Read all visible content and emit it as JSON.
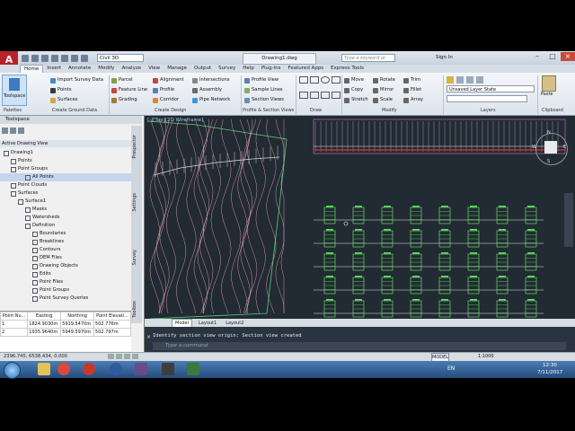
{
  "titlebar": {
    "logo": "A",
    "workspace": "Civil 3D",
    "doc_title": "Drawing1.dwg",
    "search_placeholder": "Type a keyword or phrase",
    "signin": "Sign In"
  },
  "ribbon_tabs": [
    "Home",
    "Insert",
    "Annotate",
    "Modify",
    "Analyze",
    "View",
    "Manage",
    "Output",
    "Survey",
    "Help",
    "Plug-ins",
    "Featured Apps",
    "Express Tools"
  ],
  "ribbon": {
    "toolspace_label": "Toolspace",
    "palettes": "Palettes",
    "create_ground": [
      "Import Survey Data",
      "Points",
      "Surfaces"
    ],
    "create_ground_title": "Create Ground Data",
    "design1": [
      "Parcel",
      "Feature Line",
      "Grading"
    ],
    "design2": [
      "Alignment",
      "Profile",
      "Corridor"
    ],
    "design3": [
      "Intersections",
      "Assembly",
      "Pipe Network"
    ],
    "create_design_title": "Create Design",
    "profile_views": [
      "Profile View",
      "Sample Lines",
      "Section Views"
    ],
    "profile_title": "Profile & Section Views",
    "draw_title": "Draw",
    "modify1": [
      "Move",
      "Copy",
      "Stretch"
    ],
    "modify2": [
      "Rotate",
      "Mirror",
      "Scale"
    ],
    "modify3": [
      "Trim",
      "Fillet",
      "Array"
    ],
    "modify_title": "Modify",
    "layer_state": "Unsaved Layer State",
    "layers_title": "Layers",
    "paste": "Paste",
    "clipboard_title": "Clipboard"
  },
  "toolspace": {
    "header": "Toolspace",
    "view_combo": "Active Drawing View",
    "tree": [
      {
        "label": "Drawing1",
        "indent": 0
      },
      {
        "label": "Points",
        "indent": 1
      },
      {
        "label": "Point Groups",
        "indent": 1
      },
      {
        "label": "All Points",
        "indent": 3,
        "selected": true
      },
      {
        "label": "Point Clouds",
        "indent": 1
      },
      {
        "label": "Surfaces",
        "indent": 1
      },
      {
        "label": "Surface1",
        "indent": 2
      },
      {
        "label": "Masks",
        "indent": 3
      },
      {
        "label": "Watersheds",
        "indent": 3
      },
      {
        "label": "Definition",
        "indent": 3
      },
      {
        "label": "Boundaries",
        "indent": 4
      },
      {
        "label": "Breaklines",
        "indent": 4
      },
      {
        "label": "Contours",
        "indent": 4
      },
      {
        "label": "DEM Files",
        "indent": 4
      },
      {
        "label": "Drawing Objects",
        "indent": 4
      },
      {
        "label": "Edits",
        "indent": 4
      },
      {
        "label": "Point Files",
        "indent": 4
      },
      {
        "label": "Point Groups",
        "indent": 4
      },
      {
        "label": "Point Survey Queries",
        "indent": 4
      }
    ],
    "vtabs": [
      "Prospector",
      "Settings",
      "Survey",
      "Toolbox"
    ],
    "grid_headers": [
      "Point Nu...",
      "Easting",
      "Northing",
      "Point Elevati..."
    ],
    "grid_rows": [
      [
        "1",
        "1824.9030m",
        "5919.5470m",
        "502.776m"
      ],
      [
        "2",
        "1935.9640m",
        "5949.5970m",
        "502.797m"
      ]
    ]
  },
  "drawing": {
    "view_label": "[-][Top][2D Wireframe]",
    "viewcube_top": "TOP",
    "compass": [
      "N",
      "S",
      "W",
      "E"
    ],
    "layout_tabs": [
      "Model",
      "Layout1",
      "Layout2"
    ],
    "section_columns": 8,
    "section_rows": 5
  },
  "command": {
    "history": "Identify section view origin: Section view created",
    "prompt": "Type a command"
  },
  "status": {
    "coords": "2396.745, 6538.434, 0.000",
    "model": "MODEL",
    "scale": "1:1000"
  },
  "taskbar": {
    "lang": "EN",
    "time": "12:30",
    "date": "7/11/2017"
  },
  "colors": {
    "canvas": "#222a33",
    "contour": "#e9a6b8",
    "section_green": "#5ee05e",
    "profile_red": "#d42b2b"
  }
}
